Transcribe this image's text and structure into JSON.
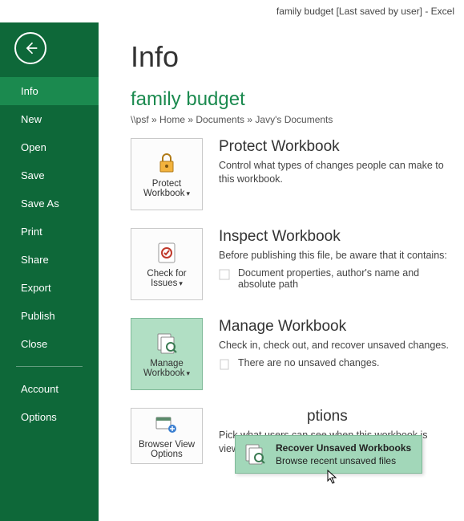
{
  "titlebar": "family budget [Last saved by user] - Excel",
  "sidebar": {
    "items": [
      {
        "label": "Info",
        "selected": true
      },
      {
        "label": "New"
      },
      {
        "label": "Open"
      },
      {
        "label": "Save"
      },
      {
        "label": "Save As"
      },
      {
        "label": "Print"
      },
      {
        "label": "Share"
      },
      {
        "label": "Export"
      },
      {
        "label": "Publish"
      },
      {
        "label": "Close"
      }
    ],
    "footer": [
      {
        "label": "Account"
      },
      {
        "label": "Options"
      }
    ]
  },
  "page": {
    "title": "Info",
    "doc_title": "family budget",
    "breadcrumb": "\\\\psf » Home » Documents » Javy's Documents"
  },
  "protect": {
    "button_line1": "Protect",
    "button_line2": "Workbook",
    "heading": "Protect Workbook",
    "desc": "Control what types of changes people can make to this workbook."
  },
  "inspect": {
    "button_line1": "Check for",
    "button_line2": "Issues",
    "heading": "Inspect Workbook",
    "desc": "Before publishing this file, be aware that it contains:",
    "bullet1": "Document properties, author's name and absolute path"
  },
  "manage": {
    "button_line1": "Manage",
    "button_line2": "Workbook",
    "heading": "Manage Workbook",
    "desc": "Check in, check out, and recover unsaved changes.",
    "bullet1": "There are no unsaved changes."
  },
  "popup": {
    "title": "Recover Unsaved Workbooks",
    "sub": "Browse recent unsaved files"
  },
  "browser": {
    "button_line1": "Browser View",
    "button_line2": "Options",
    "heading_suffix": "ptions",
    "desc": "Pick what users can see when this workbook is viewed on the Web."
  }
}
